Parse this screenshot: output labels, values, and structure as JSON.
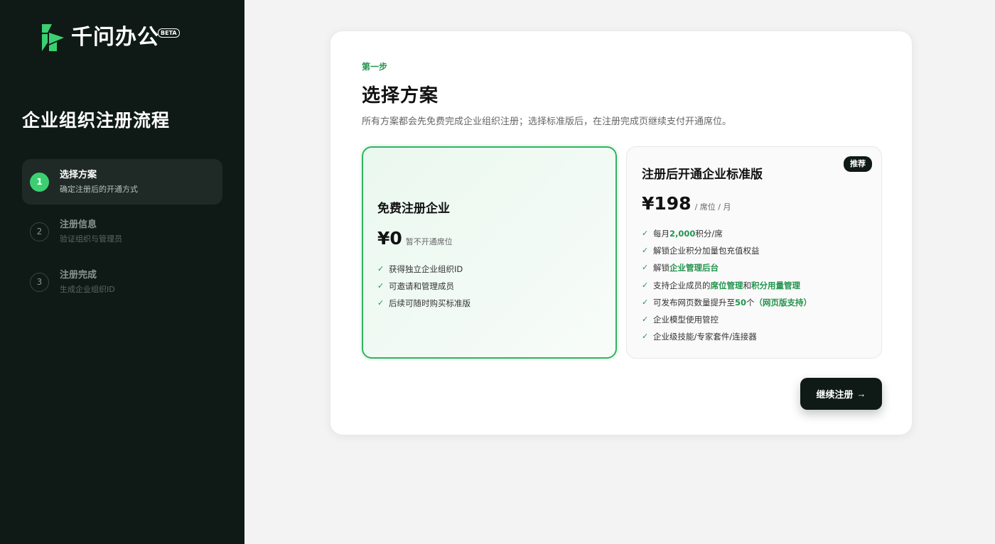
{
  "brand": {
    "name": "千问办公",
    "badge": "BETA",
    "logo_icon": "qianwen-logo-icon",
    "accent": "#3ccf72",
    "dark": "#0f1a16",
    "green_text": "#22944d"
  },
  "sidebar": {
    "title": "企业组织注册流程",
    "steps": [
      {
        "num": "1",
        "title": "选择方案",
        "sub": "确定注册后的开通方式",
        "active": true
      },
      {
        "num": "2",
        "title": "注册信息",
        "sub": "验证组织与管理员",
        "active": false
      },
      {
        "num": "3",
        "title": "注册完成",
        "sub": "生成企业组织ID",
        "active": false
      }
    ]
  },
  "main": {
    "eyebrow": "第一步",
    "title": "选择方案",
    "description": "所有方案都会先免费完成企业组织注册；选择标准版后，在注册完成页继续支付开通席位。",
    "plans": [
      {
        "name": "免费注册企业",
        "price": "¥0",
        "price_note": "暂不开通席位",
        "selected": true,
        "features": [
          "获得独立企业组织ID",
          "可邀请和管理成员",
          "后续可随时购买标准版"
        ]
      },
      {
        "name": "注册后开通企业标准版",
        "badge": "推荐",
        "price": "¥198",
        "price_note": "/ 席位 / 月",
        "selected": false,
        "features": [
          {
            "pre": "每月 ",
            "hl1": "2,000",
            "mid": " 积分/席",
            "hl2": "",
            "post": ""
          },
          {
            "pre": "解锁企业积分加量包充值权益",
            "hl1": "",
            "mid": "",
            "hl2": "",
            "post": ""
          },
          {
            "pre": "解锁 ",
            "hl1": "企业管理后台",
            "mid": "",
            "hl2": "",
            "post": ""
          },
          {
            "pre": "支持企业成员的 ",
            "hl1": "席位管理",
            "mid": " 和 ",
            "hl2": "积分用量管理",
            "post": ""
          },
          {
            "pre": "可发布网页数量提升至 ",
            "hl1": "50",
            "mid": " 个 ",
            "hl2": "（网页版支持）",
            "post": ""
          },
          {
            "pre": "企业模型使用管控",
            "hl1": "",
            "mid": "",
            "hl2": "",
            "post": ""
          },
          {
            "pre": "企业级技能/专家套件/连接器",
            "hl1": "",
            "mid": "",
            "hl2": "",
            "post": ""
          }
        ]
      }
    ],
    "continue_label": "继续注册",
    "continue_icon": "arrow-right-icon"
  }
}
